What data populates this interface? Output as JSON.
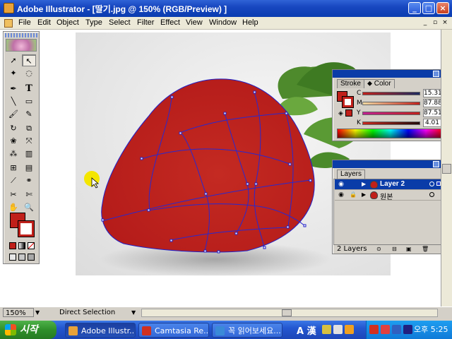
{
  "window": {
    "title": "Adobe Illustrator - [딸기.jpg @ 150% (RGB/Preview) ]",
    "buttons": [
      "minimize",
      "maximize",
      "close"
    ]
  },
  "menu": {
    "items": [
      "File",
      "Edit",
      "Object",
      "Type",
      "Select",
      "Filter",
      "Effect",
      "View",
      "Window",
      "Help"
    ]
  },
  "tools": {
    "icons": [
      "selection-arrow",
      "direct-selection-arrow",
      "magic-wand",
      "lasso",
      "pen",
      "type",
      "line",
      "rectangle",
      "paintbrush",
      "pencil",
      "rotate",
      "scale",
      "warp",
      "free-transform",
      "symbol-sprayer",
      "graph",
      "mesh",
      "gradient",
      "eyedropper",
      "blend",
      "scissors",
      "slice",
      "hand",
      "zoom"
    ],
    "fill_color": "#c0201a",
    "stroke_color": "#c0201a"
  },
  "color_panel": {
    "tabs": [
      "Stroke",
      "Color"
    ],
    "active_tab": "Color",
    "channels": [
      {
        "label": "C",
        "value": "15.31",
        "unit": "%"
      },
      {
        "label": "M",
        "value": "87.88",
        "unit": "%"
      },
      {
        "label": "Y",
        "value": "87.51",
        "unit": "%"
      },
      {
        "label": "K",
        "value": "4.01",
        "unit": "%"
      }
    ]
  },
  "layers_panel": {
    "tab": "Layers",
    "layers": [
      {
        "name": "Layer 2",
        "selected": true,
        "locked": false
      },
      {
        "name": "원본",
        "selected": false,
        "locked": true
      }
    ],
    "count_label": "2 Layers"
  },
  "status": {
    "zoom": "150%",
    "tool": "Direct Selection"
  },
  "taskbar": {
    "start_label": "시작",
    "tasks": [
      {
        "label": "Adobe Illustr...",
        "active": true,
        "icon_color": "#e8a23a"
      },
      {
        "label": "Camtasia Re...",
        "active": false,
        "icon_color": "#d03020"
      },
      {
        "label": "꼭 읽어보세요...",
        "active": false,
        "icon_color": "#3a8ad8"
      }
    ],
    "ime": "A 漢",
    "clock": "오후 5:25"
  }
}
